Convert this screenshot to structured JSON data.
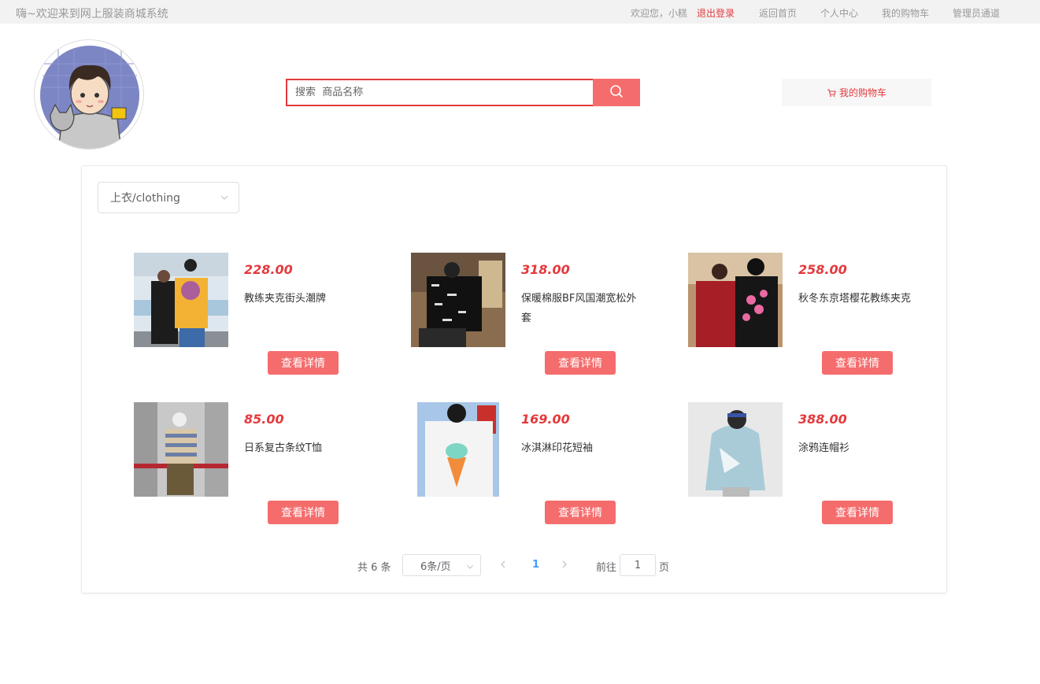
{
  "topbar": {
    "welcome": "嗨~欢迎来到网上服装商城系统",
    "greeting": "欢迎您，小糕",
    "logout": "退出登录",
    "home": "返回首页",
    "profile": "个人中心",
    "cart": "我的购物车",
    "admin": "管理员通道",
    "logout_color": "#e4393c"
  },
  "header": {
    "search_placeholder": "搜索  商品名称",
    "cart_button": "我的购物车",
    "accent": "#e4393c",
    "button_color": "#f56c6c"
  },
  "filter": {
    "category": "上衣/clothing"
  },
  "products": [
    {
      "price": "228.00",
      "name": "教练夹克街头潮牌",
      "button": "查看详情"
    },
    {
      "price": "318.00",
      "name": "保暖棉服BF风国潮宽松外套",
      "button": "查看详情"
    },
    {
      "price": "258.00",
      "name": "秋冬东京塔樱花教练夹克",
      "button": "查看详情"
    },
    {
      "price": "85.00",
      "name": "日系复古条纹T恤",
      "button": "查看详情"
    },
    {
      "price": "169.00",
      "name": "冰淇淋印花短袖",
      "button": "查看详情"
    },
    {
      "price": "388.00",
      "name": "涂鸦连帽衫",
      "button": "查看详情"
    }
  ],
  "pagination": {
    "total": "共 6 条",
    "page_size": "6条/页",
    "current": "1",
    "goto_label": "前往",
    "goto_value": "1",
    "page_unit": "页"
  }
}
